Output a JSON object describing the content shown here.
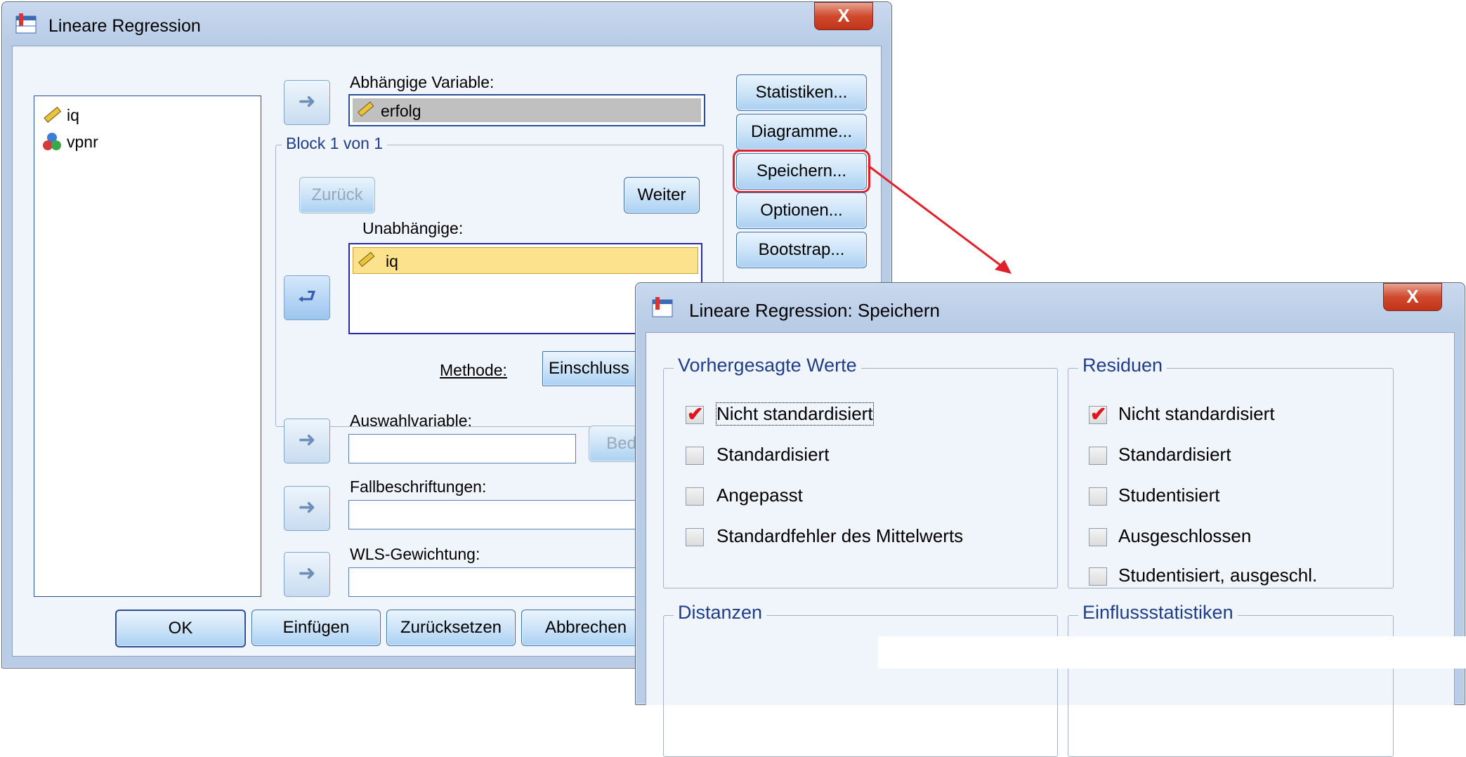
{
  "main_dialog": {
    "title": "Lineare Regression",
    "close_label": "X",
    "source_vars": [
      {
        "name": "iq",
        "icon": "ruler-icon"
      },
      {
        "name": "vpnr",
        "icon": "nominal-icon"
      }
    ],
    "dependent_label": "Abhängige Variable:",
    "dependent_value": "erfolg",
    "block_label": "Block 1 von 1",
    "back_label": "Zurück",
    "next_label": "Weiter",
    "independent_label": "Unabhängige:",
    "independent_values": [
      "iq"
    ],
    "method_label": "Methode:",
    "method_value": "Einschluss",
    "selection_label": "Auswahlvariable:",
    "condition_label": "Bedin",
    "case_label_label": "Fallbeschriftungen:",
    "wls_label": "WLS-Gewichtung:",
    "side_buttons": [
      "Statistiken...",
      "Diagramme...",
      "Speichern...",
      "Optionen...",
      "Bootstrap..."
    ],
    "bottom_buttons": [
      "OK",
      "Einfügen",
      "Zurücksetzen",
      "Abbrechen"
    ]
  },
  "save_dialog": {
    "title": "Lineare Regression: Speichern",
    "close_label": "X",
    "predicted_group": "Vorhergesagte Werte",
    "predicted_options": [
      {
        "label": "Nicht standardisiert",
        "checked": true
      },
      {
        "label": "Standardisiert",
        "checked": false
      },
      {
        "label": "Angepasst",
        "checked": false
      },
      {
        "label": "Standardfehler des Mittelwerts",
        "checked": false
      }
    ],
    "residuals_group": "Residuen",
    "residual_options": [
      {
        "label": "Nicht standardisiert",
        "checked": true
      },
      {
        "label": "Standardisiert",
        "checked": false
      },
      {
        "label": "Studentisiert",
        "checked": false
      },
      {
        "label": "Ausgeschlossen",
        "checked": false
      },
      {
        "label": "Studentisiert, ausgeschl.",
        "checked": false
      }
    ],
    "distances_group": "Distanzen",
    "influence_group": "Einflussstatistiken"
  },
  "colors": {
    "highlight": "#e0202a",
    "selection": "#fde28e",
    "dependent_bg": "#c0c0c0"
  }
}
